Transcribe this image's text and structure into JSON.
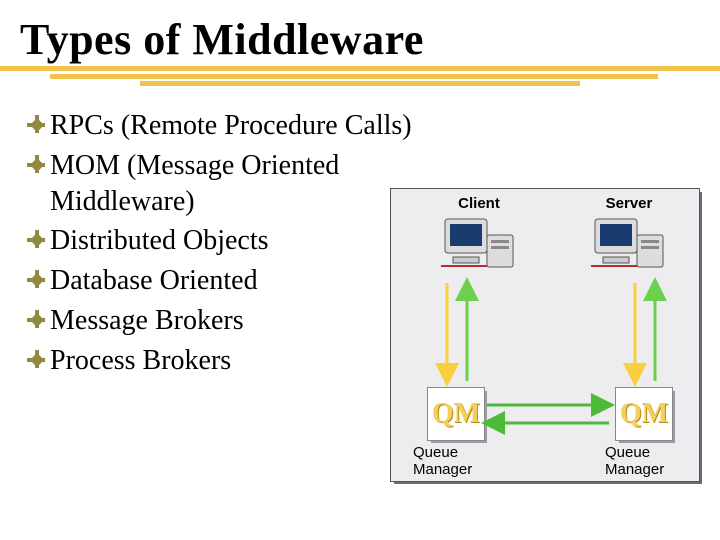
{
  "title": "Types of Middleware",
  "bullets": [
    "RPCs (Remote Procedure Calls)",
    "MOM (Message Oriented Middleware)",
    "Distributed Objects",
    "Database Oriented",
    "Message Brokers",
    "Process Brokers"
  ],
  "diagram": {
    "client_label": "Client",
    "server_label": "Server",
    "qm_inside": "QM",
    "queue_manager_label": "Queue\nManager"
  },
  "colors": {
    "accent": "#f2c44e",
    "bullet": "#918a3e",
    "arrow_down": "#f9cf40",
    "arrow_up": "#6cd04c",
    "arrow_h": "#4dbb38"
  }
}
